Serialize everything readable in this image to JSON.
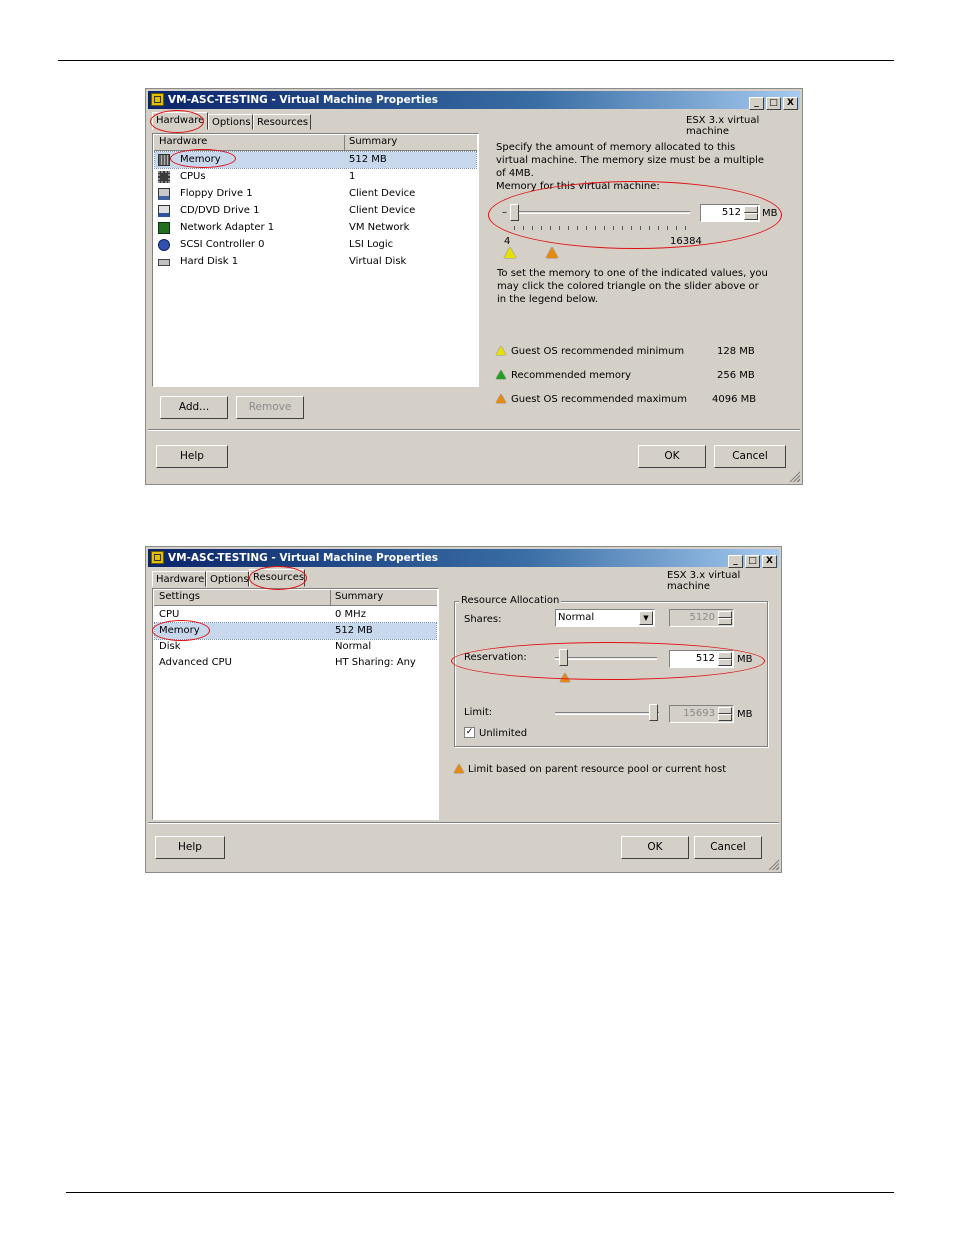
{
  "dialog1": {
    "title": "VM-ASC-TESTING - Virtual Machine Properties",
    "window_buttons": [
      "_",
      "□",
      "X"
    ],
    "tabs": [
      {
        "label": "Hardware",
        "active": true
      },
      {
        "label": "Options",
        "active": false
      },
      {
        "label": "Resources",
        "active": false
      }
    ],
    "version_label": "ESX 3.x virtual machine",
    "list_headers": {
      "col1": "Hardware",
      "col2": "Summary"
    },
    "hardware_items": [
      {
        "name": "Memory",
        "summary": "512 MB",
        "icon": "memory-icon",
        "selected": true
      },
      {
        "name": "CPUs",
        "summary": "1",
        "icon": "cpu-icon"
      },
      {
        "name": "Floppy Drive 1",
        "summary": "Client Device",
        "icon": "floppy-icon"
      },
      {
        "name": "CD/DVD Drive 1",
        "summary": "Client Device",
        "icon": "cdrom-icon"
      },
      {
        "name": "Network Adapter 1",
        "summary": "VM Network",
        "icon": "network-icon"
      },
      {
        "name": "SCSI Controller 0",
        "summary": "LSI Logic",
        "icon": "scsi-icon"
      },
      {
        "name": "Hard Disk 1",
        "summary": "Virtual Disk",
        "icon": "harddisk-icon"
      }
    ],
    "add_button": "Add...",
    "remove_button": "Remove",
    "description": "Specify the amount of memory allocated to this virtual machine. The memory size must be a multiple of 4MB.",
    "memory_label": "Memory for this virtual machine:",
    "slider_minus": "–",
    "memory_value": "512",
    "memory_unit": "MB",
    "slider_min": "4",
    "slider_max": "16384",
    "hint": "To set the memory to one of the indicated values, you may click the colored triangle on the slider above or in the legend below.",
    "legend": [
      {
        "label": "Guest OS recommended minimum",
        "value": "128 MB",
        "color": "#e8e000"
      },
      {
        "label": "Recommended memory",
        "value": "256 MB",
        "color": "#20a020"
      },
      {
        "label": "Guest OS recommended maximum",
        "value": "4096 MB",
        "color": "#e88a10"
      }
    ],
    "help_button": "Help",
    "ok_button": "OK",
    "cancel_button": "Cancel"
  },
  "dialog2": {
    "title": "VM-ASC-TESTING - Virtual Machine Properties",
    "window_buttons": [
      "_",
      "□",
      "X"
    ],
    "tabs": [
      {
        "label": "Hardware",
        "active": false
      },
      {
        "label": "Options",
        "active": false
      },
      {
        "label": "Resources",
        "active": true
      }
    ],
    "version_label": "ESX 3.x virtual machine",
    "list_headers": {
      "col1": "Settings",
      "col2": "Summary"
    },
    "settings_items": [
      {
        "name": "CPU",
        "summary": "0 MHz"
      },
      {
        "name": "Memory",
        "summary": "512 MB",
        "selected": true
      },
      {
        "name": "Disk",
        "summary": "Normal"
      },
      {
        "name": "Advanced CPU",
        "summary": "HT Sharing: Any"
      }
    ],
    "group_title": "Resource Allocation",
    "shares_label": "Shares:",
    "shares_value": "Normal",
    "shares_number": "5120",
    "reservation_label": "Reservation:",
    "reservation_value": "512",
    "reservation_unit": "MB",
    "limit_label": "Limit:",
    "limit_value": "15693",
    "limit_unit": "MB",
    "unlimited_label": "Unlimited",
    "unlimited_checked": true,
    "checkmark": "✓",
    "note": "Limit based on parent resource pool or current host",
    "help_button": "Help",
    "ok_button": "OK",
    "cancel_button": "Cancel"
  }
}
